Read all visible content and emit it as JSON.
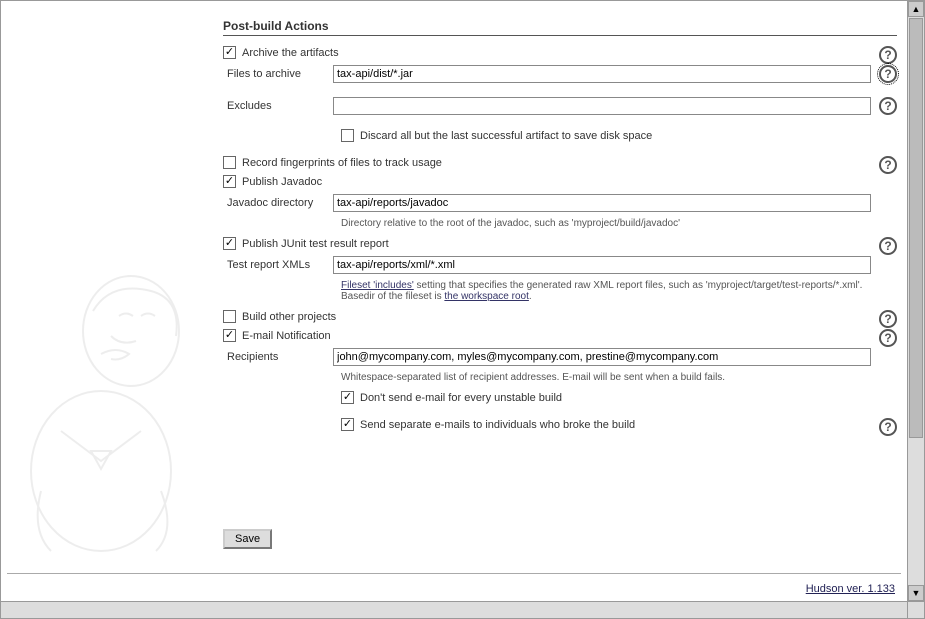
{
  "section_title": "Post-build Actions",
  "archive": {
    "checked": true,
    "label": "Archive the artifacts",
    "files_label": "Files to archive",
    "files_value": "tax-api/dist/*.jar",
    "excludes_label": "Excludes",
    "excludes_value": "",
    "discard_checked": false,
    "discard_label": "Discard all but the last successful artifact to save disk space"
  },
  "fingerprint": {
    "checked": false,
    "label": "Record fingerprints of files to track usage"
  },
  "javadoc": {
    "checked": true,
    "label": "Publish Javadoc",
    "dir_label": "Javadoc directory",
    "dir_value": "tax-api/reports/javadoc",
    "hint": "Directory relative to the root of the javadoc, such as 'myproject/build/javadoc'"
  },
  "junit": {
    "checked": true,
    "label": "Publish JUnit test result report",
    "xml_label": "Test report XMLs",
    "xml_value": "tax-api/reports/xml/*.xml",
    "hint_pre_link": "Fileset 'includes'",
    "hint_mid": " setting that specifies the generated raw XML report files, such as 'myproject/target/test-reports/*.xml'. Basedir of the fileset is ",
    "hint_link2": "the workspace root",
    "hint_end": "."
  },
  "build_other": {
    "checked": false,
    "label": "Build other projects"
  },
  "email": {
    "checked": true,
    "label": "E-mail Notification",
    "recipients_label": "Recipients",
    "recipients_value": "john@mycompany.com, myles@mycompany.com, prestine@mycompany.com",
    "hint": "Whitespace-separated list of recipient addresses. E-mail will be sent when a build fails.",
    "unstable_checked": true,
    "unstable_label": "Don't send e-mail for every unstable build",
    "individuals_checked": true,
    "individuals_label": "Send separate e-mails to individuals who broke the build"
  },
  "save_label": "Save",
  "footer": "Hudson ver. 1.133"
}
